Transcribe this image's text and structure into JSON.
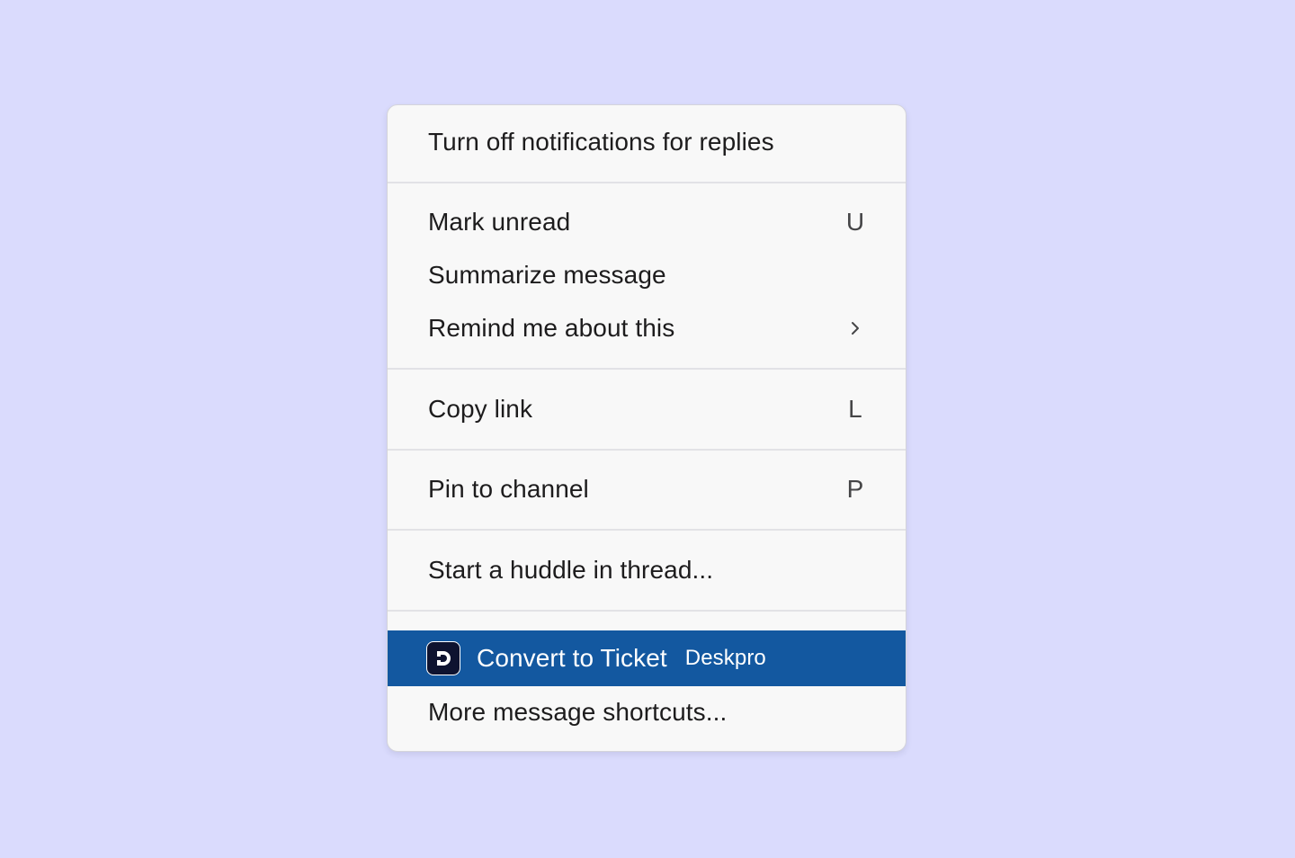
{
  "menu": {
    "notifications": {
      "label": "Turn off notifications for replies"
    },
    "mark_unread": {
      "label": "Mark unread",
      "shortcut": "U"
    },
    "summarize": {
      "label": "Summarize message"
    },
    "remind": {
      "label": "Remind me about this",
      "icon": "chevron-right-icon"
    },
    "copy_link": {
      "label": "Copy link",
      "shortcut": "L"
    },
    "pin": {
      "label": "Pin to channel",
      "shortcut": "P"
    },
    "huddle": {
      "label": "Start a huddle in thread..."
    },
    "convert": {
      "label": "Convert to Ticket",
      "app": "Deskpro",
      "icon": "deskpro-logo-icon"
    },
    "more": {
      "label": "More message shortcuts..."
    }
  },
  "colors": {
    "background": "#dadbfd",
    "menu_bg": "#f8f8f8",
    "highlight": "#1358a0",
    "text": "#1d1c1d"
  }
}
